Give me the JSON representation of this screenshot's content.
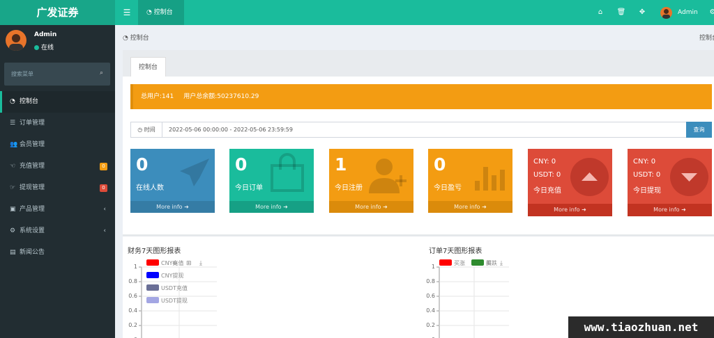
{
  "header": {
    "brand": "广发证券",
    "tab_label": "控制台",
    "icons": [
      "home-icon",
      "trash-icon",
      "fullscreen-icon",
      "user-avatar",
      "gear-icon"
    ],
    "user": "Admin"
  },
  "sidebar": {
    "user_name": "Admin",
    "status": "在线",
    "search_placeholder": "搜索菜单",
    "items": [
      {
        "label": "控制台",
        "icon": "dashboard-icon",
        "active": true
      },
      {
        "label": "订单管理",
        "icon": "list-icon"
      },
      {
        "label": "会员管理",
        "icon": "users-icon"
      },
      {
        "label": "充值管理",
        "icon": "hand-icon",
        "badge": "0",
        "badge_color": "#f39c12"
      },
      {
        "label": "提现管理",
        "icon": "hand-icon",
        "badge": "0",
        "badge_color": "#dd4b39"
      },
      {
        "label": "产品管理",
        "icon": "briefcase-icon",
        "arrow": "‹"
      },
      {
        "label": "系统设置",
        "icon": "gears-icon",
        "arrow": "‹"
      },
      {
        "label": "新闻公告",
        "icon": "newspaper-icon"
      }
    ]
  },
  "breadcrumb": {
    "left": "控制台",
    "right": "控制台"
  },
  "panel": {
    "tab": "控制台"
  },
  "alert": {
    "total_users": "总用户:141",
    "total_balance": "用户总余额:50237610.29"
  },
  "time_filter": {
    "label": "时间",
    "value": "2022-05-06 00:00:00 - 2022-05-06 23:59:59",
    "button": "查询"
  },
  "stats": [
    {
      "value": "0",
      "label": "在线人数",
      "more": "More info",
      "color": "#3c8dbc",
      "footer_color": "#357ca5",
      "icon": "paper-plane-icon"
    },
    {
      "value": "0",
      "label": "今日订单",
      "more": "More info",
      "color": "#1abc9c",
      "footer_color": "#16a085",
      "icon": "shopping-bag-icon"
    },
    {
      "value": "1",
      "label": "今日注册",
      "more": "More info",
      "color": "#f39c12",
      "footer_color": "#db8b0b",
      "icon": "user-plus-icon"
    },
    {
      "value": "0",
      "label": "今日盈亏",
      "more": "More info",
      "color": "#f39c12",
      "footer_color": "#db8b0b",
      "icon": "bar-chart-icon"
    }
  ],
  "money_stats": [
    {
      "cny": "CNY:  0",
      "usdt": "USDT:  0",
      "label": "今日充值",
      "more": "More info",
      "icon": "arrow-up-icon"
    },
    {
      "cny": "CNY:  0",
      "usdt": "USDT:  0",
      "label": "今日提现",
      "more": "More info",
      "icon": "arrow-down-icon"
    }
  ],
  "charts": {
    "finance_title": "财务7天图形报表",
    "order_title": "订单7天图形报表"
  },
  "chart_data": [
    {
      "type": "line",
      "title": "财务7天图形报表",
      "series": [
        {
          "name": "CNY充值",
          "color": "#ff0000",
          "values": []
        },
        {
          "name": "CNY提现",
          "color": "#0000ff",
          "values": []
        },
        {
          "name": "USDT充值",
          "color": "#6a6f96",
          "values": []
        },
        {
          "name": "USDT提现",
          "color": "#a3a6e3",
          "values": []
        }
      ],
      "y_ticks": [
        "1",
        "0.8",
        "0.6",
        "0.4",
        "0.2",
        "0"
      ],
      "ylim": [
        0,
        1
      ]
    },
    {
      "type": "line",
      "title": "订单7天图形报表",
      "series": [
        {
          "name": "买涨",
          "color": "#ff0000",
          "values": []
        },
        {
          "name": "买跌",
          "color": "#2e8b2e",
          "values": []
        }
      ],
      "y_ticks": [
        "1",
        "0.8",
        "0.6",
        "0.4",
        "0.2",
        "0"
      ],
      "ylim": [
        0,
        1
      ]
    }
  ],
  "watermark": "www.tiaozhuan.net"
}
